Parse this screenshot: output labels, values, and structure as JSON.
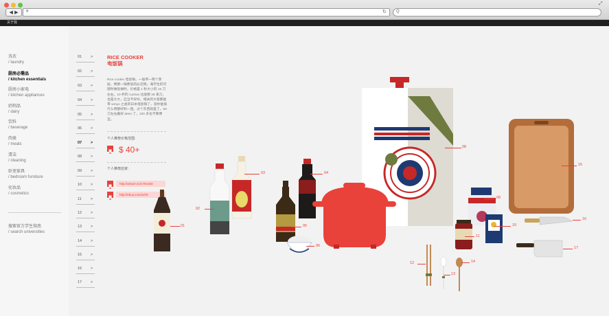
{
  "browser": {
    "back_forward": "◀ ▶",
    "new_tab": "+",
    "expand": "⤢",
    "reload": "↻",
    "search_glyph": "Q"
  },
  "site_header": {
    "label": "关于我"
  },
  "sidebar": {
    "items": [
      {
        "cn": "洗衣",
        "en": "/ laundry"
      },
      {
        "cn": "厨房必需品",
        "en": "/ kitchen essentials"
      },
      {
        "cn": "厨房小家电",
        "en": "/ kitchen appliances"
      },
      {
        "cn": "奶制品",
        "en": "/ dairy"
      },
      {
        "cn": "饮料",
        "en": "/ beverage"
      },
      {
        "cn": "肉类",
        "en": "/ meats"
      },
      {
        "cn": "清洁",
        "en": "/ cleaning"
      },
      {
        "cn": "卧室家具",
        "en": "/ bedroom furniture"
      },
      {
        "cn": "化妆品",
        "en": "/ cosmetics"
      }
    ],
    "search": {
      "cn": "搜索官方学生指南",
      "en": "/ search universities"
    }
  },
  "pages": {
    "numbers": [
      "01",
      "02",
      "03",
      "04",
      "05",
      "06",
      "07",
      "08",
      "09",
      "10",
      "11",
      "12",
      "13",
      "14",
      "15",
      "16",
      "17"
    ],
    "arrow": ">",
    "active": "07"
  },
  "info": {
    "title_en": "RICE COOKER",
    "title_cn": "电饭锅",
    "description": "Rice cooker 电饭锅，一般带一两个蒸屉，煮粥一锅煮饭的必还物，海学生的可随时做饭做时。价格是 1 秒大小的 15 刀左右。10 杯的 cuckoo 也能要 28 来刀。也是大大，应当不好拎。相关的大家都能带 wmyo 之类的日本电饭锅了。就你能按行么用都好和一直。过个东西就是了。60 刀左右最好 deen 了，100 多也不算便宜。",
    "price_label": "个人推荐价格范围:",
    "price": "$ 40+",
    "shop_label": "个人推荐店家:",
    "links": [
      "http://amazn.to/1764183",
      "http://ebuy.com/azh9"
    ]
  },
  "items": {
    "labels": [
      "01",
      "02",
      "03",
      "04",
      "05",
      "06",
      "07",
      "08",
      "09",
      "10",
      "11",
      "12",
      "13",
      "14",
      "15",
      "16",
      "17"
    ]
  },
  "colors": {
    "accent": "#e8423a",
    "dark_bar": "#1f1f1f",
    "navy": "#1e3a73",
    "olive": "#6f7a3e"
  }
}
